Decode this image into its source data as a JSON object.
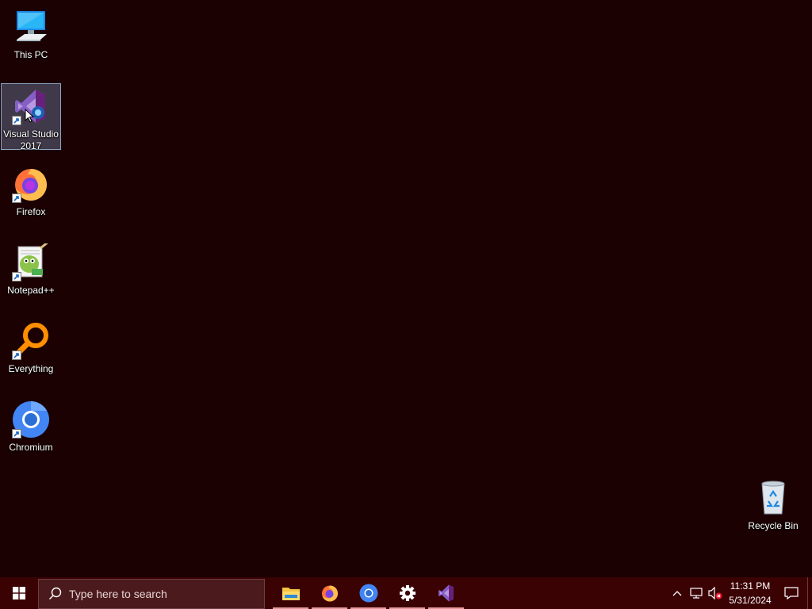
{
  "desktop": {
    "icons": [
      {
        "name": "This PC",
        "icon": "computer-icon",
        "shortcut": false
      },
      {
        "name": "Visual Studio 2017",
        "icon": "visual-studio-icon",
        "shortcut": true,
        "selected": true
      },
      {
        "name": "Firefox",
        "icon": "firefox-icon",
        "shortcut": true
      },
      {
        "name": "Notepad++",
        "icon": "notepadpp-icon",
        "shortcut": true
      },
      {
        "name": "Everything",
        "icon": "everything-search-icon",
        "shortcut": true
      },
      {
        "name": "Chromium",
        "icon": "chromium-icon",
        "shortcut": true
      },
      {
        "name": "Recycle Bin",
        "icon": "recycle-bin-icon",
        "shortcut": false
      }
    ]
  },
  "taskbar": {
    "search_placeholder": "Type here to search",
    "apps": [
      {
        "name": "File Explorer",
        "icon": "folder-icon"
      },
      {
        "name": "Firefox",
        "icon": "firefox-icon"
      },
      {
        "name": "Chromium",
        "icon": "chromium-icon"
      },
      {
        "name": "Settings",
        "icon": "gear-icon"
      },
      {
        "name": "Visual Studio 2017",
        "icon": "visual-studio-icon"
      }
    ],
    "clock": {
      "time": "11:31 PM",
      "date": "5/31/2024"
    }
  },
  "colors": {
    "desktop_bg": "#1c0103",
    "taskbar_bg": "#3b0204",
    "search_bg": "#4b1a1d",
    "active_indicator": "#e99a9f"
  }
}
